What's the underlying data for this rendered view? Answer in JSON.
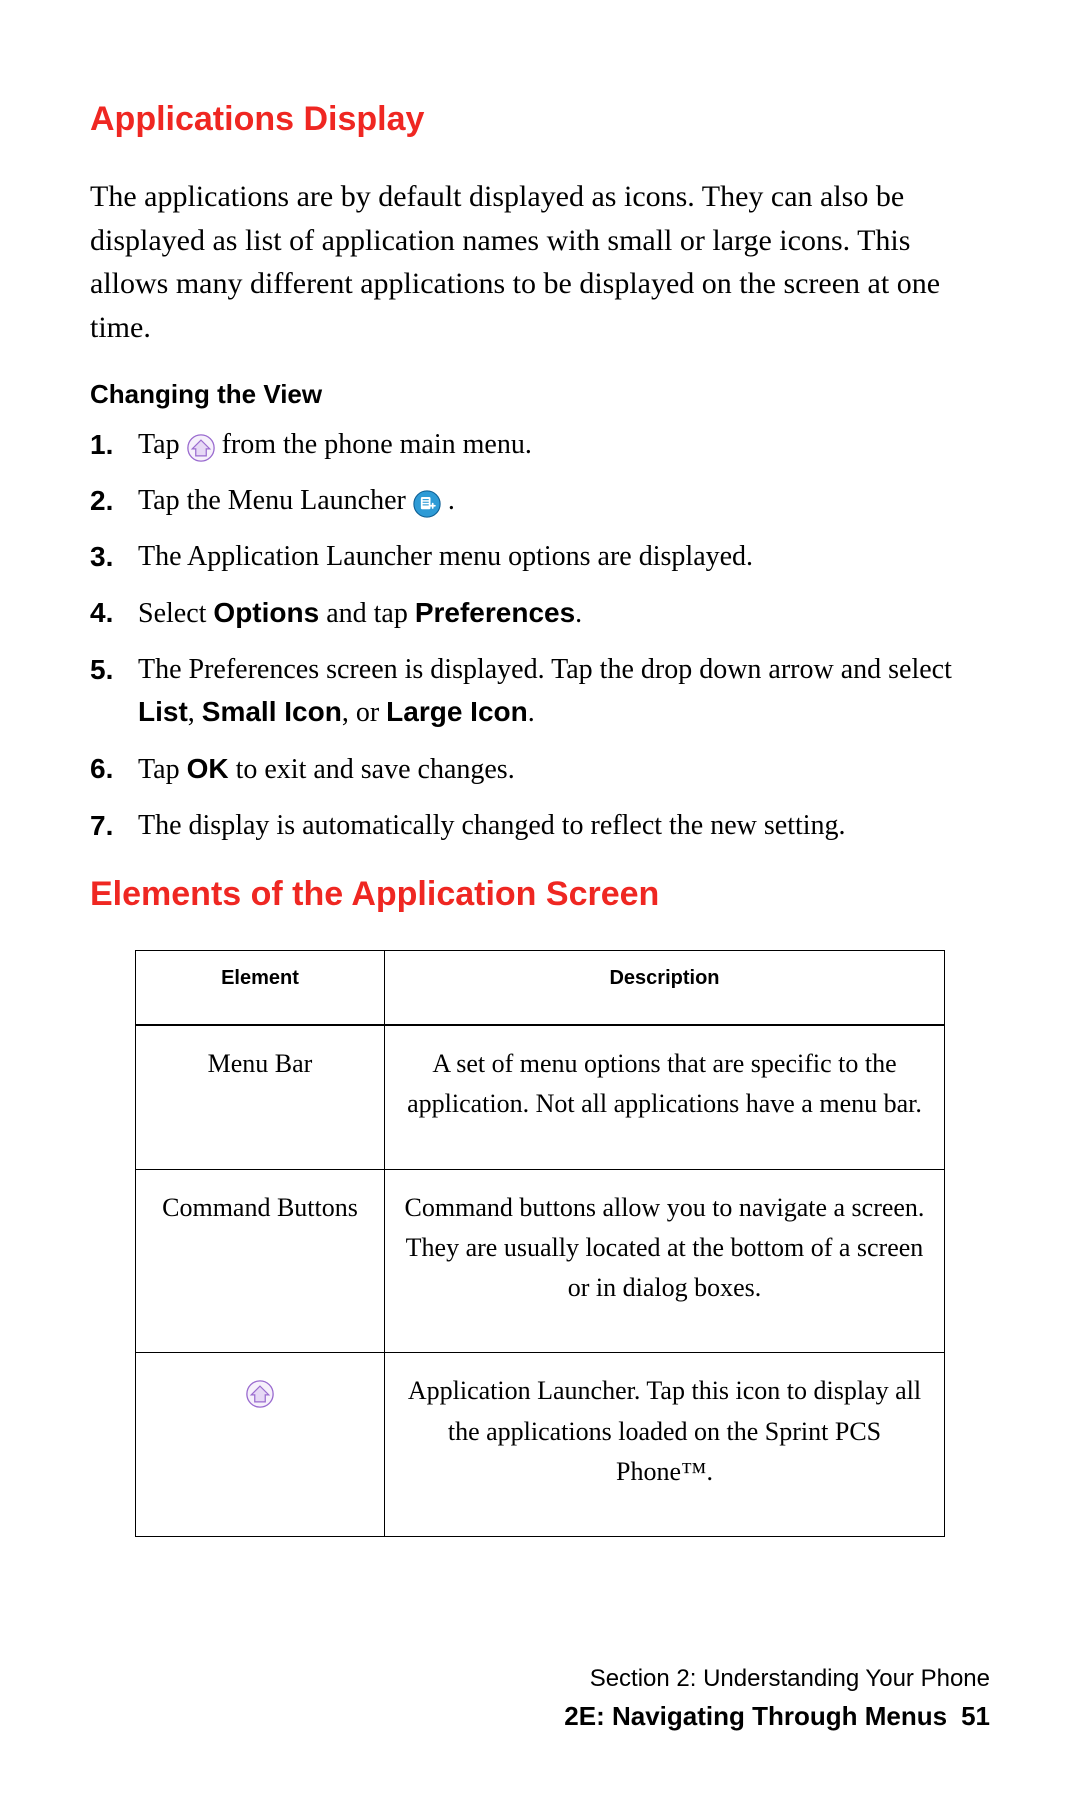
{
  "headings": {
    "h1": "Applications Display",
    "intro": "The applications are by default displayed as icons. They can also be displayed as list of application names with small or large icons. This allows many different applications to be displayed on the screen at one time.",
    "sub": "Changing the View",
    "h2": "Elements of the Application Screen"
  },
  "steps": {
    "s1a": "Tap ",
    "s1b": " from the phone main menu.",
    "s2a": "Tap the Menu Launcher ",
    "s2b": ".",
    "s3": "The Application Launcher menu options are displayed.",
    "s4a": "Select ",
    "s4b": "Options",
    "s4c": " and tap ",
    "s4d": "Preferences",
    "s4e": ".",
    "s5a": "The Preferences screen is displayed. Tap the drop down arrow and select ",
    "s5b": "List",
    "s5c": ", ",
    "s5d": "Small Icon",
    "s5e": ", or ",
    "s5f": "Large Icon",
    "s5g": ".",
    "s6a": "Tap ",
    "s6b": "OK",
    "s6c": " to exit and save changes.",
    "s7": "The display is automatically changed to reflect the new setting."
  },
  "table": {
    "head_el": "Element",
    "head_desc": "Description",
    "r1_el": "Menu Bar",
    "r1_desc": "A set of menu options that are specific to the application. Not all applications have a menu bar.",
    "r2_el": "Command Buttons",
    "r2_desc": "Command buttons allow you to navigate a screen. They are usually located at the bottom of a screen or in dialog boxes.",
    "r3_desc": "Application Launcher. Tap this icon to display all the applications loaded on the Sprint PCS Phone™."
  },
  "footer": {
    "section": "Section 2: Understanding Your Phone",
    "chapter": "2E: Navigating Through Menus",
    "page": "51"
  }
}
